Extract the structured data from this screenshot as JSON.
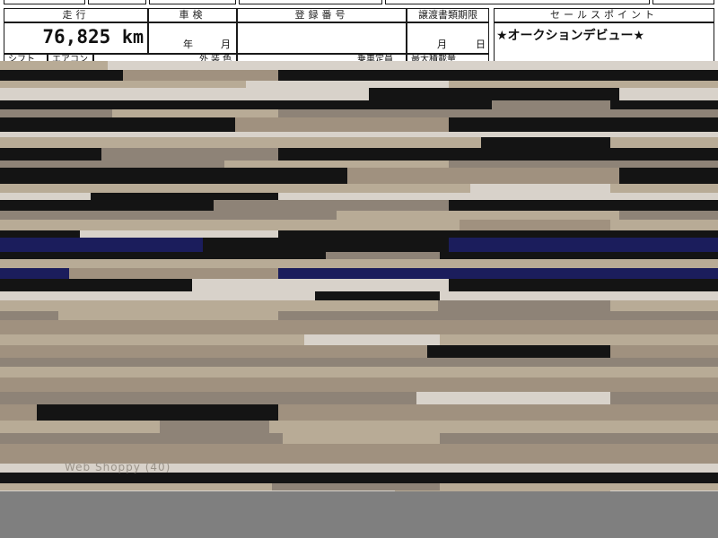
{
  "sheet": {
    "headers": {
      "mileage": "走行",
      "inspection": "車検",
      "registration_number": "登録番号",
      "transfer_deadline": "譲渡書類期限",
      "sales_point": "セールスポイント"
    },
    "values": {
      "mileage": "76,825",
      "mileage_unit": "km",
      "inspection_year": "年",
      "inspection_month": "月",
      "registration_number": "",
      "transfer_month": "月",
      "transfer_day": "日",
      "sales_point": "★オークションデビュー★"
    },
    "row3": {
      "shift": "シフト",
      "aircon": "エアコン",
      "exterior_color": "外装色",
      "capacity": "乗車定員",
      "max_load": "最大積載量"
    }
  },
  "photo": {
    "caption": "Web Shoppy (40)",
    "colors": {
      "dark": "#141414",
      "navy": "#1b1d5c",
      "tan": "#b8ab96",
      "gray": "#8e8377",
      "light": "#d8d2ca",
      "floor": "#a0917f",
      "bottom_band": "#7f7f7f"
    }
  }
}
